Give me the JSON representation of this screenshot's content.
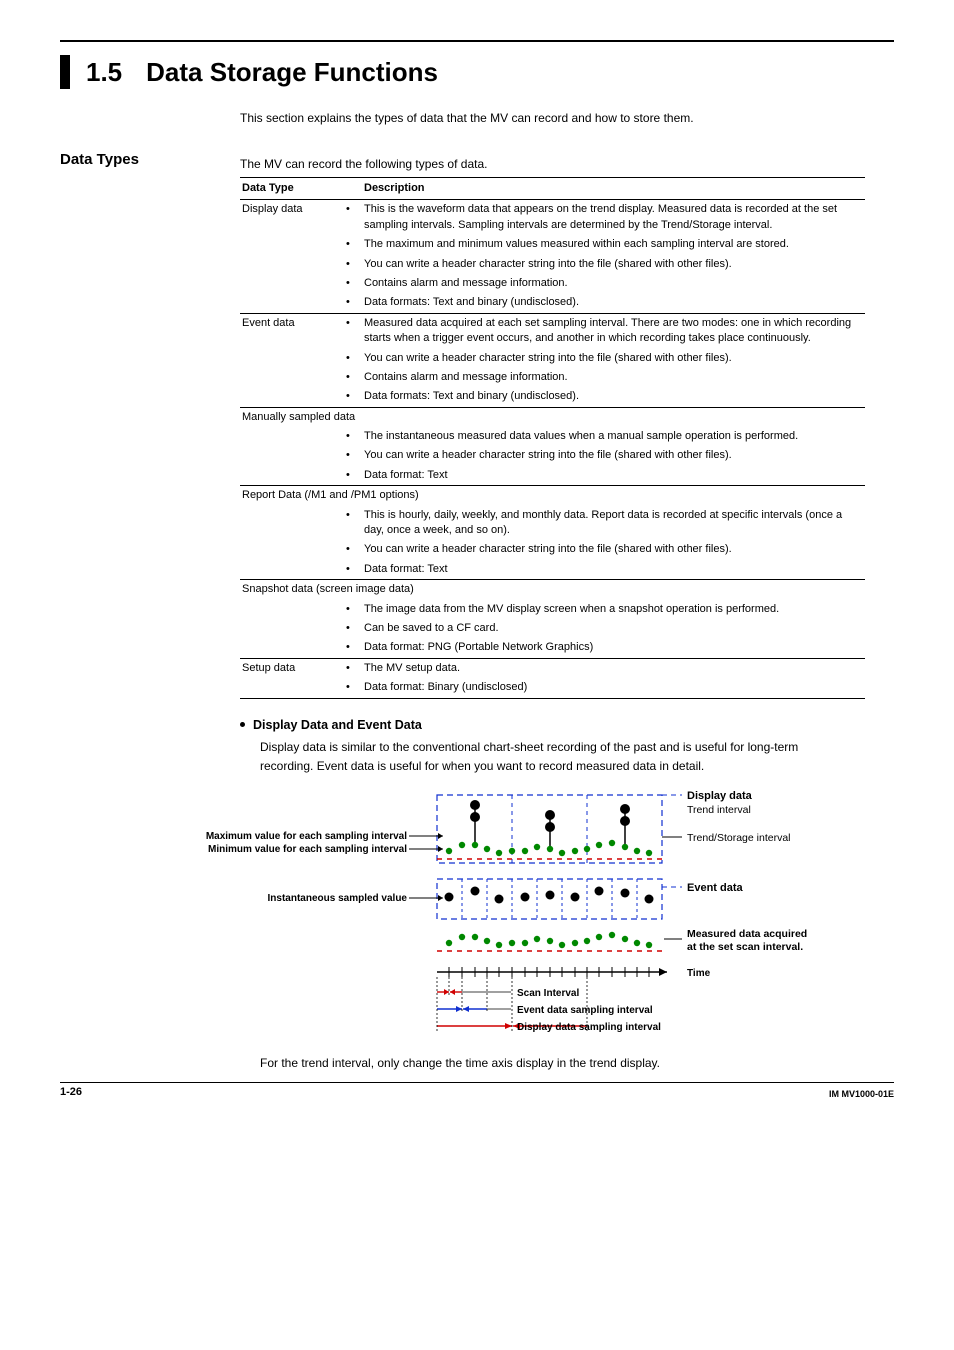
{
  "header": {
    "number": "1.5",
    "title": "Data Storage Functions",
    "intro": "This section explains the types of data that the MV can record and how to store them."
  },
  "datatypes": {
    "heading": "Data Types",
    "lead": "The MV can record the following types of data.",
    "th_type": "Data Type",
    "th_desc": "Description",
    "rows": [
      {
        "type": "Display data",
        "text": "This is the waveform data that appears on the trend display. Measured data is recorded at the set sampling intervals. Sampling intervals are determined by the Trend/Storage interval.",
        "sep": true
      },
      {
        "type": "",
        "text": "The maximum and minimum values measured within each sampling interval are stored."
      },
      {
        "type": "",
        "text": "You can write a header character string into the file (shared with other files)."
      },
      {
        "type": "",
        "text": "Contains alarm and message information."
      },
      {
        "type": "",
        "text": "Data formats: Text and binary (undisclosed)."
      },
      {
        "type": "Event data",
        "text": "Measured data acquired at each set sampling interval. There are two modes: one in which recording starts when a trigger event occurs, and another in which recording takes place continuously.",
        "sep": true
      },
      {
        "type": "",
        "text": "You can write a header character string into the file (shared with other files)."
      },
      {
        "type": "",
        "text": "Contains alarm and message information."
      },
      {
        "type": "",
        "text": "Data formats: Text and binary (undisclosed)."
      },
      {
        "type": "Manually sampled data",
        "span": true,
        "sep": true
      },
      {
        "type": "",
        "text": "The instantaneous measured data values when a manual sample operation is performed."
      },
      {
        "type": "",
        "text": "You can write a header character string into the file (shared with other files)."
      },
      {
        "type": "",
        "text": "Data format: Text"
      },
      {
        "type": "Report Data (/M1 and /PM1 options)",
        "span": true,
        "sep": true
      },
      {
        "type": "",
        "text": "This is hourly, daily, weekly, and monthly data. Report data is recorded at specific intervals (once a day, once a week, and so on)."
      },
      {
        "type": "",
        "text": "You can write a header character string into the file (shared with other files)."
      },
      {
        "type": "",
        "text": "Data format: Text"
      },
      {
        "type": "Snapshot data (screen image data)",
        "span": true,
        "sep": true
      },
      {
        "type": "",
        "text": "The image data from the MV display screen when a snapshot operation is performed."
      },
      {
        "type": "",
        "text": "Can be saved to a CF card."
      },
      {
        "type": "",
        "text": "Data format: PNG (Portable Network Graphics)"
      },
      {
        "type": "Setup data",
        "text": "The MV setup data.",
        "sep": true
      },
      {
        "type": "",
        "text": "Data format: Binary (undisclosed)",
        "last": true
      }
    ]
  },
  "subsection": {
    "title": "Display Data and Event Data",
    "para": "Display data is similar to the conventional chart-sheet recording of the past and is useful for long-term recording. Event data is useful for when you want to record measured data in detail."
  },
  "diagram": {
    "left": {
      "max": "Maximum value for each sampling interval",
      "min": "Minimum value for each sampling interval",
      "inst": "Instantaneous sampled value"
    },
    "right": {
      "dd": "Display data",
      "ti": "Trend interval",
      "tsi": "Trend/Storage interval",
      "ed": "Event data",
      "md1": "Measured data acquired",
      "md2": "at the set scan interval.",
      "time": "Time"
    },
    "bottom": {
      "si": "Scan Interval",
      "edsi": "Event data sampling interval",
      "ddsi": "Display data sampling interval"
    },
    "caption": "For the trend interval, only change the time axis display in the trend display."
  },
  "footer": {
    "page": "1-26",
    "code": "IM MV1000-01E"
  }
}
